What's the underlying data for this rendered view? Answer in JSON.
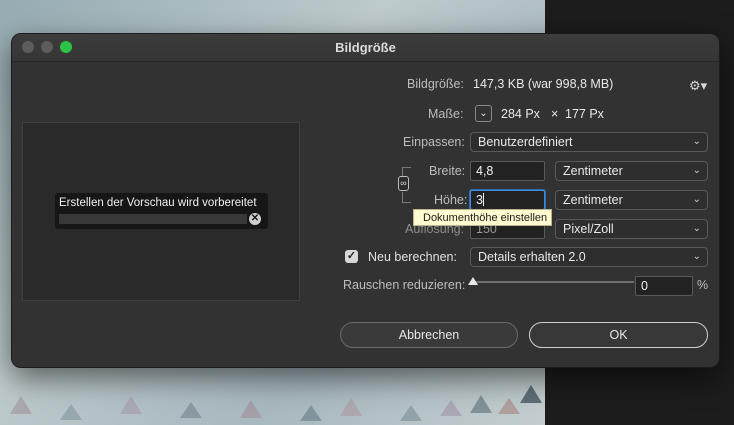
{
  "dialog": {
    "title": "Bildgröße",
    "image_size_label": "Bildgröße:",
    "image_size_value": "147,3 KB (war 998,8 MB)",
    "dimensions_label": "Maße:",
    "dimensions_width": "284 Px",
    "dimensions_sep": "×",
    "dimensions_height": "177 Px",
    "fit_label": "Einpassen:",
    "fit_value": "Benutzerdefiniert",
    "width_label": "Breite:",
    "width_value": "4,8",
    "width_unit": "Zentimeter",
    "height_label": "Höhe:",
    "height_value": "3",
    "height_unit": "Zentimeter",
    "tooltip": "Dokumenthöhe einstellen",
    "resolution_label": "Auflösung:",
    "resolution_value": "150",
    "resolution_unit": "Pixel/Zoll",
    "resample_label": "Neu berechnen:",
    "resample_checked": true,
    "resample_value": "Details erhalten 2.0",
    "noise_label": "Rauschen reduzieren:",
    "noise_value": "0",
    "noise_unit": "%",
    "noise_level": 0,
    "cancel_label": "Abbrechen",
    "ok_label": "OK"
  },
  "preview": {
    "progress_label": "Erstellen der Vorschau wird vorbereitet"
  },
  "icons": {
    "gear": "gear-icon",
    "chain": "link-icon",
    "dims_toggle": "chevron-down-icon"
  },
  "colors": {
    "dialog_bg": "#323232",
    "focus": "#3f8dd8",
    "tooltip_bg": "#fffbd0",
    "maximize": "#2dc344"
  }
}
